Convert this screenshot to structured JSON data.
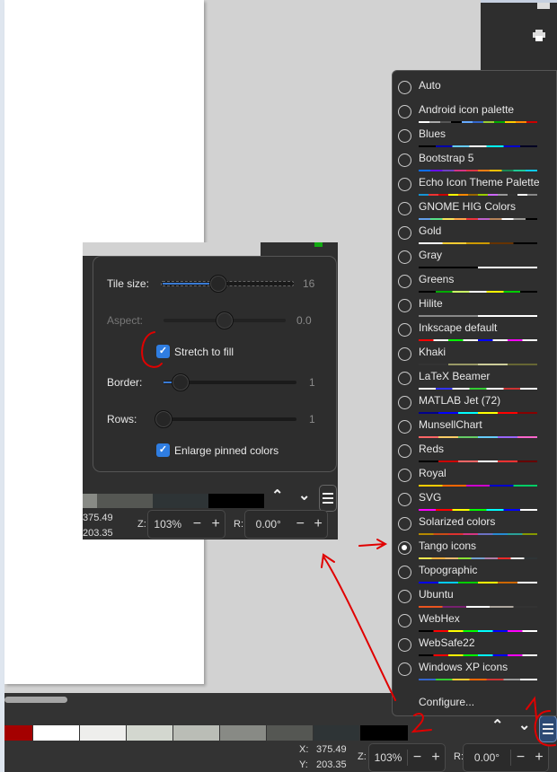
{
  "popup": {
    "tile_size_label": "Tile size:",
    "tile_size_value": "16",
    "tile_size_fraction": 0.43,
    "aspect_label": "Aspect:",
    "aspect_value": "0.0",
    "aspect_fraction": 0.5,
    "stretch_label": "Stretch to fill",
    "stretch_checked": true,
    "border_label": "Border:",
    "border_value": "1",
    "border_fraction": 0.05,
    "rows_label": "Rows:",
    "rows_value": "1",
    "rows_fraction": 0,
    "enlarge_label": "Enlarge pinned colors",
    "enlarge_checked": true
  },
  "status": {
    "x_label": "X:",
    "x_value": "375.49",
    "y_label": "Y:",
    "y_value": "203.35",
    "zoom_label": "Z:",
    "zoom_value": "103%",
    "rot_label": "R:",
    "rot_value": "0.00°",
    "minus": "−",
    "plus": "+"
  },
  "swatches": [
    "#a40000",
    "#ffffff",
    "#eeeeec",
    "#d3d7cf",
    "#babdb6",
    "#888a85",
    "#555753",
    "#2e3436",
    "#000000"
  ],
  "palettes": [
    {
      "name": "Auto",
      "colors": []
    },
    {
      "name": "Android icon palette",
      "colors": [
        "#fff",
        "#aaa",
        "#555",
        "#000",
        "#6af",
        "#36c",
        "#9c3",
        "#0a0",
        "#fc0",
        "#f80",
        "#c00"
      ]
    },
    {
      "name": "Blues",
      "colors": [
        "#000",
        "#00a",
        "#6cf",
        "#fff",
        "#0ff",
        "#00c",
        "#002"
      ]
    },
    {
      "name": "Bootstrap 5",
      "colors": [
        "#0d6efd",
        "#6610f2",
        "#6f42c1",
        "#d63384",
        "#dc3545",
        "#fd7e14",
        "#ffc107",
        "#198754",
        "#20c997",
        "#0dcaf0"
      ]
    },
    {
      "name": "Echo Icon Theme Palette",
      "colors": [
        "#1793d1",
        "#e33",
        "#c00",
        "#ff0",
        "#f80",
        "#960",
        "#9c0",
        "#c6f",
        "#999",
        "#333",
        "#fff",
        "#888"
      ]
    },
    {
      "name": "GNOME HIG Colors",
      "colors": [
        "#62a0ea",
        "#57e389",
        "#f8e45c",
        "#ffa348",
        "#ed333b",
        "#c061cb",
        "#b5835a",
        "#fff",
        "#9a9996",
        "#000"
      ]
    },
    {
      "name": "Gold",
      "colors": [
        "#fff",
        "#fc3",
        "#c90",
        "#630",
        "#000"
      ]
    },
    {
      "name": "Gray",
      "colors": [
        "#000",
        "#fff"
      ]
    },
    {
      "name": "Greens",
      "colors": [
        "#000",
        "#0a0",
        "#cf6",
        "#fff",
        "#ff0",
        "#0c0",
        "#000"
      ]
    },
    {
      "name": "Hilite",
      "colors": [
        "#888",
        "#fff"
      ]
    },
    {
      "name": "Inkscape default",
      "colors": [
        "#f00",
        "#fff",
        "#0f0",
        "#fff",
        "#00f",
        "#fff",
        "#f0f",
        "#fff"
      ]
    },
    {
      "name": "Khaki",
      "colors": [
        "#333",
        "#996",
        "#cc9",
        "#663"
      ]
    },
    {
      "name": "LaTeX Beamer",
      "colors": [
        "#fff",
        "#33f",
        "#fff",
        "#3c3",
        "#fff",
        "#c33",
        "#fff"
      ]
    },
    {
      "name": "MATLAB Jet (72)",
      "colors": [
        "#00008f",
        "#00f",
        "#0ff",
        "#ff0",
        "#f00",
        "#800"
      ]
    },
    {
      "name": "MunsellChart",
      "colors": [
        "#f66",
        "#fc6",
        "#6c6",
        "#6cf",
        "#96f",
        "#f6c"
      ]
    },
    {
      "name": "Reds",
      "colors": [
        "#000",
        "#c00",
        "#f66",
        "#fff",
        "#f33",
        "#600"
      ]
    },
    {
      "name": "Royal",
      "colors": [
        "#fc0",
        "#f60",
        "#c0c",
        "#00c",
        "#0c6"
      ]
    },
    {
      "name": "SVG",
      "colors": [
        "#f0f",
        "#f00",
        "#ff0",
        "#0f0",
        "#0ff",
        "#00f",
        "#fff"
      ]
    },
    {
      "name": "Solarized colors",
      "colors": [
        "#b58900",
        "#cb4b16",
        "#dc322f",
        "#d33682",
        "#6c71c4",
        "#268bd2",
        "#2aa198",
        "#859900"
      ]
    },
    {
      "name": "Tango icons",
      "colors": [
        "#fce94f",
        "#fcaf3e",
        "#e9b96e",
        "#8ae234",
        "#729fcf",
        "#ad7fa8",
        "#ef2929",
        "#eeeeec",
        "#2e3436"
      ]
    },
    {
      "name": "Topographic",
      "colors": [
        "#00f",
        "#0cf",
        "#0c0",
        "#ff0",
        "#c60",
        "#fff"
      ]
    },
    {
      "name": "Ubuntu",
      "colors": [
        "#e95420",
        "#77216f",
        "#fff",
        "#aea79f",
        "#333"
      ]
    },
    {
      "name": "WebHex",
      "colors": [
        "#000",
        "#f00",
        "#ff0",
        "#0f0",
        "#0ff",
        "#00f",
        "#f0f",
        "#fff"
      ]
    },
    {
      "name": "WebSafe22",
      "colors": [
        "#000",
        "#f00",
        "#ff0",
        "#0f0",
        "#0ff",
        "#00f",
        "#f0f",
        "#fff"
      ]
    },
    {
      "name": "Windows XP icons",
      "colors": [
        "#36c",
        "#3c3",
        "#fc3",
        "#f60",
        "#c33",
        "#999",
        "#fff"
      ]
    }
  ],
  "selected_palette": "Tango icons",
  "configure_label": "Configure...",
  "annotations": {
    "label_1": "1",
    "label_2": "2",
    "color": "#e00000"
  }
}
